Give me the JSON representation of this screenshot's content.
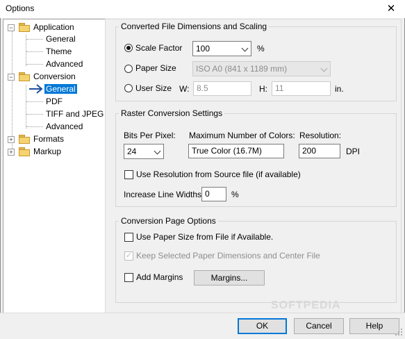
{
  "window": {
    "title": "Options",
    "close_glyph": "✕"
  },
  "tree": {
    "application": {
      "label": "Application",
      "expander": "−"
    },
    "application_children": [
      "General",
      "Theme",
      "Advanced"
    ],
    "conversion": {
      "label": "Conversion",
      "expander": "−"
    },
    "conversion_children": [
      "General",
      "PDF",
      "TIFF and JPEG",
      "Advanced"
    ],
    "formats": {
      "label": "Formats",
      "expander": "+"
    },
    "markup": {
      "label": "Markup",
      "expander": "+"
    },
    "selected": "General"
  },
  "dimensions": {
    "title": "Converted File Dimensions and Scaling",
    "scale_factor_label": "Scale Factor",
    "scale_factor_value": "100",
    "scale_unit": "%",
    "paper_size_label": "Paper Size",
    "paper_size_value": "ISO A0 (841 x 1189 mm)",
    "user_size_label": "User Size",
    "w_label": "W:",
    "w_value": "8.5",
    "h_label": "H:",
    "h_value": "11",
    "unit": "in.",
    "selected_option": "Scale Factor"
  },
  "raster": {
    "title": "Raster Conversion Settings",
    "bits_label": "Bits Per Pixel:",
    "bits_value": "24",
    "max_colors_label": "Maximum Number of Colors:",
    "max_colors_value": "True Color (16.7M)",
    "resolution_label": "Resolution:",
    "resolution_value": "200",
    "resolution_unit": "DPI",
    "use_resolution_label": "Use Resolution from Source file (if available)",
    "use_resolution_checked": false,
    "line_width_label": "Increase Line Widths:",
    "line_width_value": "0",
    "line_width_unit": "%"
  },
  "page_options": {
    "title": "Conversion Page Options",
    "use_paper_size_label": "Use Paper Size from File if Available.",
    "use_paper_size_checked": false,
    "keep_dimensions_label": "Keep Selected Paper Dimensions and Center File",
    "keep_dimensions_checked": true,
    "keep_dimensions_enabled": false,
    "add_margins_label": "Add Margins",
    "add_margins_checked": false,
    "margins_button": "Margins..."
  },
  "buttons": {
    "ok": "OK",
    "cancel": "Cancel",
    "help": "Help"
  },
  "watermark": "SOFTPEDIA"
}
